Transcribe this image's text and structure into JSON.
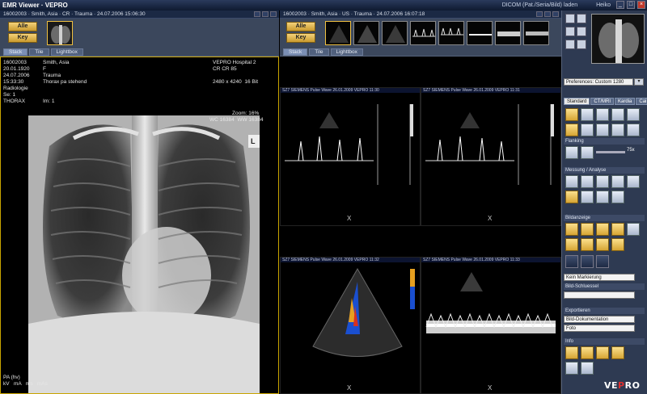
{
  "window": {
    "title": "EMR Viewer · VEPRO",
    "status_right": "DICOM (Pat./Seria/Bild) laden",
    "user": "Heiko"
  },
  "left_panel": {
    "header": "16002003 · Smith, Asia · CR · Trauma · 24.07.2006 15:06:30",
    "btn_alle": "Alle",
    "btn_key": "Key",
    "tabs": [
      "Stack",
      "Tile",
      "Lighttbox"
    ],
    "overlay_tl": [
      "16002003",
      "20.01.1920",
      "F",
      "24.07.2006",
      "15:33:30",
      "Radiologie",
      "Se: 1",
      "THORAX"
    ],
    "overlay_tl_names": [
      "Smith, Asia",
      "",
      "Trauma",
      "Thorax pa stehend",
      "",
      "",
      "Im: 1"
    ],
    "overlay_tr": [
      "VEPRO Hospital 2",
      "CR CR 85",
      "",
      "2480 x 4240  16 Bit"
    ],
    "zoom": "Zoom: 16%",
    "window_level": "WC 16384  WW 16384",
    "orientation": "L",
    "overlay_bl": [
      "PA (hv)",
      "kV   mA   ms   mAs"
    ]
  },
  "mid_panel": {
    "header": "16002003 · Smith, Asia · US · Trauma · 24.07.2006 16:07:18",
    "btn_alle": "Alle",
    "btn_key": "Key",
    "tabs": [
      "Stack",
      "Tile",
      "Lighttbox"
    ],
    "cells": [
      {
        "hdr": "SZ7 SIEMENS   Pulse Wave   26.01.2009  VEPRO  11:30"
      },
      {
        "hdr": "SZ7 SIEMENS   Pulse Wave   26.01.2009  VEPRO  11:31"
      },
      {
        "hdr": "SZ7 SIEMENS   Pulse Wave   26.01.2009  VEPRO  11:32"
      },
      {
        "hdr": "SZ7 SIEMENS   Pulse Wave   26.01.2009  VEPRO  11:33"
      }
    ],
    "close_glyph": "X"
  },
  "right_panel": {
    "preset_label": "Preferences: Custom 1280",
    "tabs": [
      "Standard",
      "CT/MRI",
      "Kardia",
      "Cai"
    ],
    "sections": {
      "zoom": "Flanking",
      "measure": "Messung / Analyse",
      "display": "Bildanzeige",
      "key": "Kein Markierung",
      "assoc": "Bild-Schluessel",
      "export": "Exportieren",
      "misc": "Info"
    },
    "inputs": {
      "key_select": "Kein Markierung",
      "export_value": "Bild-Dokumentation",
      "export_value2": "Foto"
    },
    "zoom_value": "75x",
    "logo_pre": "VE",
    "logo_mid": "P",
    "logo_post": "RO"
  }
}
